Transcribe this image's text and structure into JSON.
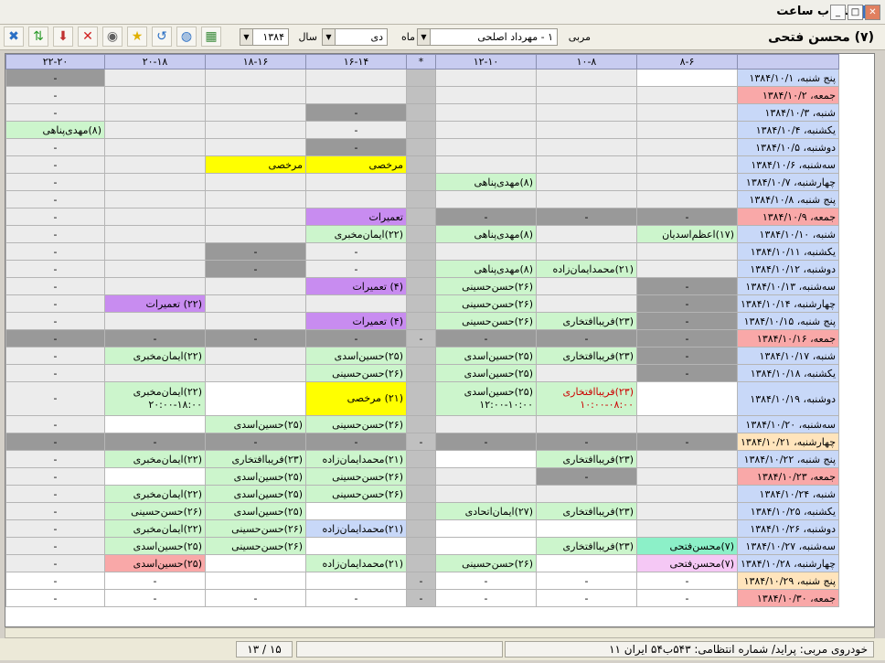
{
  "window": {
    "title": "انتخاب ساعت"
  },
  "header": {
    "coach_title": "(۷) محسن فتحی",
    "instructor_label": "مربی",
    "instructor_value": "۱ - مهرداد اصلحی",
    "month_label": "ماه",
    "month_value": "دی",
    "year_label": "سال",
    "year_value": "۱۳۸۴"
  },
  "toolbar": {
    "icons": [
      "exit-icon",
      "transfer-icon",
      "download-icon",
      "delete-icon",
      "disk-icon",
      "star-icon",
      "refresh-icon",
      "globe-icon",
      "print-icon"
    ]
  },
  "columns": [
    "",
    "۸-۶",
    "۱۰-۸",
    "۱۲-۱۰",
    "*",
    "۱۶-۱۴",
    "۱۸-۱۶",
    "۲۰-۱۸",
    "۲۲-۲۰"
  ],
  "rows": [
    {
      "date": "پنج شنبه، ۱۳۸۴/۱۰/۱",
      "dc": "blue",
      "cells": [
        [
          "",
          "white"
        ],
        [
          "",
          "lgray"
        ],
        [
          "",
          "lgray"
        ],
        [
          "",
          "sep"
        ],
        [
          "",
          "lgray"
        ],
        [
          "",
          "lgray"
        ],
        [
          "",
          "lgray"
        ],
        [
          "-",
          "gray"
        ]
      ]
    },
    {
      "date": "جمعه، ۱۳۸۴/۱۰/۲",
      "dc": "pink",
      "cells": [
        [
          "",
          "lgray"
        ],
        [
          "",
          "lgray"
        ],
        [
          "",
          "lgray"
        ],
        [
          "",
          "sep"
        ],
        [
          "",
          "lgray"
        ],
        [
          "",
          "lgray"
        ],
        [
          "",
          "lgray"
        ],
        [
          "-",
          "lgray"
        ]
      ]
    },
    {
      "date": "شنبه، ۱۳۸۴/۱۰/۳",
      "dc": "blue",
      "cells": [
        [
          "",
          "lgray"
        ],
        [
          "",
          "lgray"
        ],
        [
          "",
          "lgray"
        ],
        [
          "",
          "sep"
        ],
        [
          "-",
          "gray"
        ],
        [
          "",
          "lgray"
        ],
        [
          "",
          "lgray"
        ],
        [
          "-",
          "lgray"
        ]
      ]
    },
    {
      "date": "یکشنبه، ۱۳۸۴/۱۰/۴",
      "dc": "blue",
      "cells": [
        [
          "",
          "lgray"
        ],
        [
          "",
          "lgray"
        ],
        [
          "",
          "lgray"
        ],
        [
          "",
          "sep"
        ],
        [
          "-",
          "lgray"
        ],
        [
          "",
          "lgray"
        ],
        [
          "",
          "lgray"
        ],
        [
          "(۸)مهدی‌پناهی",
          "green"
        ]
      ]
    },
    {
      "date": "دوشنبه، ۱۳۸۴/۱۰/۵",
      "dc": "blue",
      "cells": [
        [
          "",
          "lgray"
        ],
        [
          "",
          "lgray"
        ],
        [
          "",
          "lgray"
        ],
        [
          "",
          "sep"
        ],
        [
          "-",
          "gray"
        ],
        [
          "",
          "lgray"
        ],
        [
          "",
          "lgray"
        ],
        [
          "-",
          "lgray"
        ]
      ]
    },
    {
      "date": "سه‌شنبه، ۱۳۸۴/۱۰/۶",
      "dc": "blue",
      "cells": [
        [
          "",
          "lgray"
        ],
        [
          "",
          "lgray"
        ],
        [
          "",
          "lgray"
        ],
        [
          "",
          "sep"
        ],
        [
          "مرخصی",
          "yellow"
        ],
        [
          "مرخصی",
          "yellow"
        ],
        [
          "",
          "lgray"
        ],
        [
          "-",
          "lgray"
        ]
      ]
    },
    {
      "date": "چهارشنبه، ۱۳۸۴/۱۰/۷",
      "dc": "blue",
      "cells": [
        [
          "",
          "lgray"
        ],
        [
          "",
          "lgray"
        ],
        [
          "(۸)مهدی‌پناهی",
          "green"
        ],
        [
          "",
          "sep"
        ],
        [
          "",
          "lgray"
        ],
        [
          "",
          "lgray"
        ],
        [
          "",
          "lgray"
        ],
        [
          "-",
          "lgray"
        ]
      ]
    },
    {
      "date": "پنج شنبه، ۱۳۸۴/۱۰/۸",
      "dc": "blue",
      "cells": [
        [
          "",
          "lgray"
        ],
        [
          "",
          "lgray"
        ],
        [
          "",
          "lgray"
        ],
        [
          "",
          "sep"
        ],
        [
          "",
          "lgray"
        ],
        [
          "",
          "lgray"
        ],
        [
          "",
          "lgray"
        ],
        [
          "-",
          "lgray"
        ]
      ]
    },
    {
      "date": "جمعه، ۱۳۸۴/۱۰/۹",
      "dc": "pink",
      "cells": [
        [
          "-",
          "gray"
        ],
        [
          "-",
          "gray"
        ],
        [
          "-",
          "gray"
        ],
        [
          "",
          "sep"
        ],
        [
          "تعمیرات",
          "purple"
        ],
        [
          "",
          "lgray"
        ],
        [
          "",
          "lgray"
        ],
        [
          "-",
          "lgray"
        ]
      ]
    },
    {
      "date": "شنبه، ۱۳۸۴/۱۰/۱۰",
      "dc": "blue",
      "cells": [
        [
          "(۱۷)اعظم‌اسدیان",
          "green"
        ],
        [
          "",
          "lgray"
        ],
        [
          "(۸)مهدی‌پناهی",
          "green"
        ],
        [
          "",
          "sep"
        ],
        [
          "(۲۲)ایمان‌مخبری",
          "green"
        ],
        [
          "",
          "lgray"
        ],
        [
          "",
          "lgray"
        ],
        [
          "-",
          "lgray"
        ]
      ]
    },
    {
      "date": "یکشنبه، ۱۳۸۴/۱۰/۱۱",
      "dc": "blue",
      "cells": [
        [
          "",
          "lgray"
        ],
        [
          "",
          "lgray"
        ],
        [
          "",
          "lgray"
        ],
        [
          "",
          "sep"
        ],
        [
          "-",
          "lgray"
        ],
        [
          "-",
          "gray"
        ],
        [
          "",
          "lgray"
        ],
        [
          "-",
          "lgray"
        ]
      ]
    },
    {
      "date": "دوشنبه، ۱۳۸۴/۱۰/۱۲",
      "dc": "blue",
      "cells": [
        [
          "",
          "lgray"
        ],
        [
          "(۲۱)محمدایمان‌زاده",
          "green"
        ],
        [
          "(۸)مهدی‌پناهی",
          "green"
        ],
        [
          "",
          "sep"
        ],
        [
          "-",
          "lgray"
        ],
        [
          "-",
          "gray"
        ],
        [
          "",
          "lgray"
        ],
        [
          "-",
          "lgray"
        ]
      ]
    },
    {
      "date": "سه‌شنبه، ۱۳۸۴/۱۰/۱۳",
      "dc": "blue",
      "cells": [
        [
          "-",
          "gray"
        ],
        [
          "",
          "lgray"
        ],
        [
          "(۲۶)حسن‌حسینی",
          "green"
        ],
        [
          "",
          "sep"
        ],
        [
          "(۴) تعمیرات",
          "purple"
        ],
        [
          "",
          "lgray"
        ],
        [
          "",
          "lgray"
        ],
        [
          "-",
          "lgray"
        ]
      ]
    },
    {
      "date": "چهارشنبه، ۱۳۸۴/۱۰/۱۴",
      "dc": "blue",
      "cells": [
        [
          "-",
          "gray"
        ],
        [
          "",
          "lgray"
        ],
        [
          "(۲۶)حسن‌حسینی",
          "green"
        ],
        [
          "",
          "sep"
        ],
        [
          "",
          "lgray"
        ],
        [
          "",
          "lgray"
        ],
        [
          "(۲۲) تعمیرات",
          "purple"
        ],
        [
          "-",
          "lgray"
        ]
      ]
    },
    {
      "date": "پنج شنبه، ۱۳۸۴/۱۰/۱۵",
      "dc": "blue",
      "cells": [
        [
          "-",
          "gray"
        ],
        [
          "(۲۳)فریباافتخاری",
          "green"
        ],
        [
          "(۲۶)حسن‌حسینی",
          "green"
        ],
        [
          "",
          "sep"
        ],
        [
          "(۴) تعمیرات",
          "purple"
        ],
        [
          "",
          "lgray"
        ],
        [
          "",
          "lgray"
        ],
        [
          "-",
          "lgray"
        ]
      ]
    },
    {
      "date": "جمعه، ۱۳۸۴/۱۰/۱۶",
      "dc": "pink",
      "cells": [
        [
          "-",
          "gray"
        ],
        [
          "-",
          "gray"
        ],
        [
          "-",
          "gray"
        ],
        [
          "-",
          "sep"
        ],
        [
          "-",
          "gray"
        ],
        [
          "-",
          "gray"
        ],
        [
          "-",
          "gray"
        ],
        [
          "-",
          "gray"
        ]
      ]
    },
    {
      "date": "شنبه، ۱۳۸۴/۱۰/۱۷",
      "dc": "blue",
      "cells": [
        [
          "-",
          "gray"
        ],
        [
          "(۲۳)فریباافتخاری",
          "green"
        ],
        [
          "(۲۵)حسین‌اسدی",
          "green"
        ],
        [
          "",
          "sep"
        ],
        [
          "(۲۵)حسین‌اسدی",
          "green"
        ],
        [
          "",
          "lgray"
        ],
        [
          "(۲۲)ایمان‌مخبری",
          "green"
        ],
        [
          "-",
          "lgray"
        ]
      ]
    },
    {
      "date": "یکشنبه، ۱۳۸۴/۱۰/۱۸",
      "dc": "blue",
      "cells": [
        [
          "-",
          "gray"
        ],
        [
          "",
          "lgray"
        ],
        [
          "(۲۵)حسین‌اسدی",
          "green"
        ],
        [
          "",
          "sep"
        ],
        [
          "(۲۶)حسن‌حسینی",
          "green"
        ],
        [
          "",
          "lgray"
        ],
        [
          "",
          "lgray"
        ],
        [
          "-",
          "lgray"
        ]
      ]
    },
    {
      "date": "دوشنبه، ۱۳۸۴/۱۰/۱۹",
      "dc": "blue",
      "tall": true,
      "cells": [
        [
          "",
          "white"
        ],
        [
          "(۲۳)فریباافتخاری\n۱۰:۰۰-۰۸:۰۰",
          "green red"
        ],
        [
          "(۲۵)حسین‌اسدی\n۱۲:۰۰-۱۰:۰۰",
          "green"
        ],
        [
          "",
          "sep"
        ],
        [
          "(۲۱) مرخصی",
          "yellow"
        ],
        [
          "",
          "white"
        ],
        [
          "(۲۲)ایمان‌مخبری\n۲۰:۰۰-۱۸:۰۰",
          "green"
        ],
        [
          "-",
          "lgray"
        ]
      ]
    },
    {
      "date": "سه‌شنبه، ۱۳۸۴/۱۰/۲۰",
      "dc": "blue",
      "cells": [
        [
          "",
          "lgray"
        ],
        [
          "",
          "lgray"
        ],
        [
          "",
          "lgray"
        ],
        [
          "",
          "sep"
        ],
        [
          "(۲۶)حسن‌حسینی",
          "green"
        ],
        [
          "(۲۵)حسین‌اسدی",
          "green"
        ],
        [
          "",
          "white"
        ],
        [
          "-",
          "lgray"
        ]
      ]
    },
    {
      "date": "چهارشنبه، ۱۳۸۴/۱۰/۲۱",
      "dc": "orange",
      "cells": [
        [
          "-",
          "gray"
        ],
        [
          "-",
          "gray"
        ],
        [
          "-",
          "gray"
        ],
        [
          "-",
          "sep"
        ],
        [
          "-",
          "gray"
        ],
        [
          "-",
          "gray"
        ],
        [
          "-",
          "gray"
        ],
        [
          "-",
          "gray"
        ]
      ]
    },
    {
      "date": "پنج شنبه، ۱۳۸۴/۱۰/۲۲",
      "dc": "blue",
      "cells": [
        [
          "",
          "lgray"
        ],
        [
          "(۲۳)فریباافتخاری",
          "green"
        ],
        [
          "",
          "white"
        ],
        [
          "",
          "sep"
        ],
        [
          "(۲۱)محمدایمان‌زاده",
          "green"
        ],
        [
          "(۲۳)فریباافتخاری",
          "green"
        ],
        [
          "(۲۲)ایمان‌مخبری",
          "green"
        ],
        [
          "-",
          "lgray"
        ]
      ]
    },
    {
      "date": "جمعه، ۱۳۸۴/۱۰/۲۳",
      "dc": "pink",
      "cells": [
        [
          "",
          "lgray"
        ],
        [
          "-",
          "gray"
        ],
        [
          "",
          "lgray"
        ],
        [
          "",
          "sep"
        ],
        [
          "(۲۶)حسن‌حسینی",
          "green"
        ],
        [
          "(۲۵)حسین‌اسدی",
          "green"
        ],
        [
          "",
          "white"
        ],
        [
          "-",
          "lgray"
        ]
      ]
    },
    {
      "date": "شنبه، ۱۳۸۴/۱۰/۲۴",
      "dc": "blue",
      "cells": [
        [
          "",
          "lgray"
        ],
        [
          "",
          "lgray"
        ],
        [
          "",
          "lgray"
        ],
        [
          "",
          "sep"
        ],
        [
          "(۲۶)حسن‌حسینی",
          "green"
        ],
        [
          "(۲۵)حسین‌اسدی",
          "green"
        ],
        [
          "(۲۲)ایمان‌مخبری",
          "green"
        ],
        [
          "-",
          "lgray"
        ]
      ]
    },
    {
      "date": "یکشنبه، ۱۳۸۴/۱۰/۲۵",
      "dc": "blue",
      "cells": [
        [
          "",
          "lgray"
        ],
        [
          "(۲۳)فریباافتخاری",
          "green"
        ],
        [
          "(۲۷)ایمان‌اتحادی",
          "green"
        ],
        [
          "",
          "sep"
        ],
        [
          "",
          "white"
        ],
        [
          "(۲۵)حسین‌اسدی",
          "green"
        ],
        [
          "(۲۶)حسن‌حسینی",
          "green"
        ],
        [
          "-",
          "lgray"
        ]
      ]
    },
    {
      "date": "دوشنبه، ۱۳۸۴/۱۰/۲۶",
      "dc": "blue",
      "cells": [
        [
          "",
          "lgray"
        ],
        [
          "",
          "white"
        ],
        [
          "",
          "white"
        ],
        [
          "",
          "sep"
        ],
        [
          "(۲۱)محمدایمان‌زاده",
          "blue"
        ],
        [
          "(۲۶)حسن‌حسینی",
          "green"
        ],
        [
          "(۲۲)ایمان‌مخبری",
          "green"
        ],
        [
          "-",
          "lgray"
        ]
      ]
    },
    {
      "date": "سه‌شنبه، ۱۳۸۴/۱۰/۲۷",
      "dc": "blue",
      "cells": [
        [
          "(۷)محسن‌فتحی",
          "teal"
        ],
        [
          "(۲۳)فریباافتخاری",
          "green"
        ],
        [
          "",
          "white"
        ],
        [
          "",
          "sep"
        ],
        [
          "",
          "white"
        ],
        [
          "(۲۶)حسن‌حسینی",
          "green"
        ],
        [
          "(۲۵)حسین‌اسدی",
          "green"
        ],
        [
          "-",
          "lgray"
        ]
      ]
    },
    {
      "date": "چهارشنبه، ۱۳۸۴/۱۰/۲۸",
      "dc": "blue",
      "cells": [
        [
          "(۷)محسن‌فتحی",
          "lpink"
        ],
        [
          "",
          "white"
        ],
        [
          "(۲۶)حسن‌حسینی",
          "green"
        ],
        [
          "",
          "sep"
        ],
        [
          "(۲۱)محمدایمان‌زاده",
          "green"
        ],
        [
          "",
          "white"
        ],
        [
          "(۲۵)حسین‌اسدی",
          "pink"
        ],
        [
          "-",
          "lgray"
        ]
      ]
    },
    {
      "date": "پنج شنبه، ۱۳۸۴/۱۰/۲۹",
      "dc": "orange",
      "cells": [
        [
          "-",
          "white"
        ],
        [
          "-",
          "white"
        ],
        [
          "-",
          "white"
        ],
        [
          "-",
          "sep"
        ],
        [
          "",
          "white"
        ],
        [
          "",
          "white"
        ],
        [
          "-",
          "white"
        ],
        [
          "-",
          "white"
        ]
      ]
    },
    {
      "date": "جمعه، ۱۳۸۴/۱۰/۳۰",
      "dc": "pink",
      "cells": [
        [
          "-",
          "white"
        ],
        [
          "-",
          "white"
        ],
        [
          "-",
          "white"
        ],
        [
          "-",
          "sep"
        ],
        [
          "-",
          "white"
        ],
        [
          "-",
          "white"
        ],
        [
          "-",
          "white"
        ],
        [
          "-",
          "white"
        ]
      ]
    }
  ],
  "status": {
    "page": "۱۵ / ۱۳",
    "vehicle": "خودروی مربی: پراید/ شماره انتظامی: ۵۴۳ب۵۴ ایران ۱۱"
  }
}
